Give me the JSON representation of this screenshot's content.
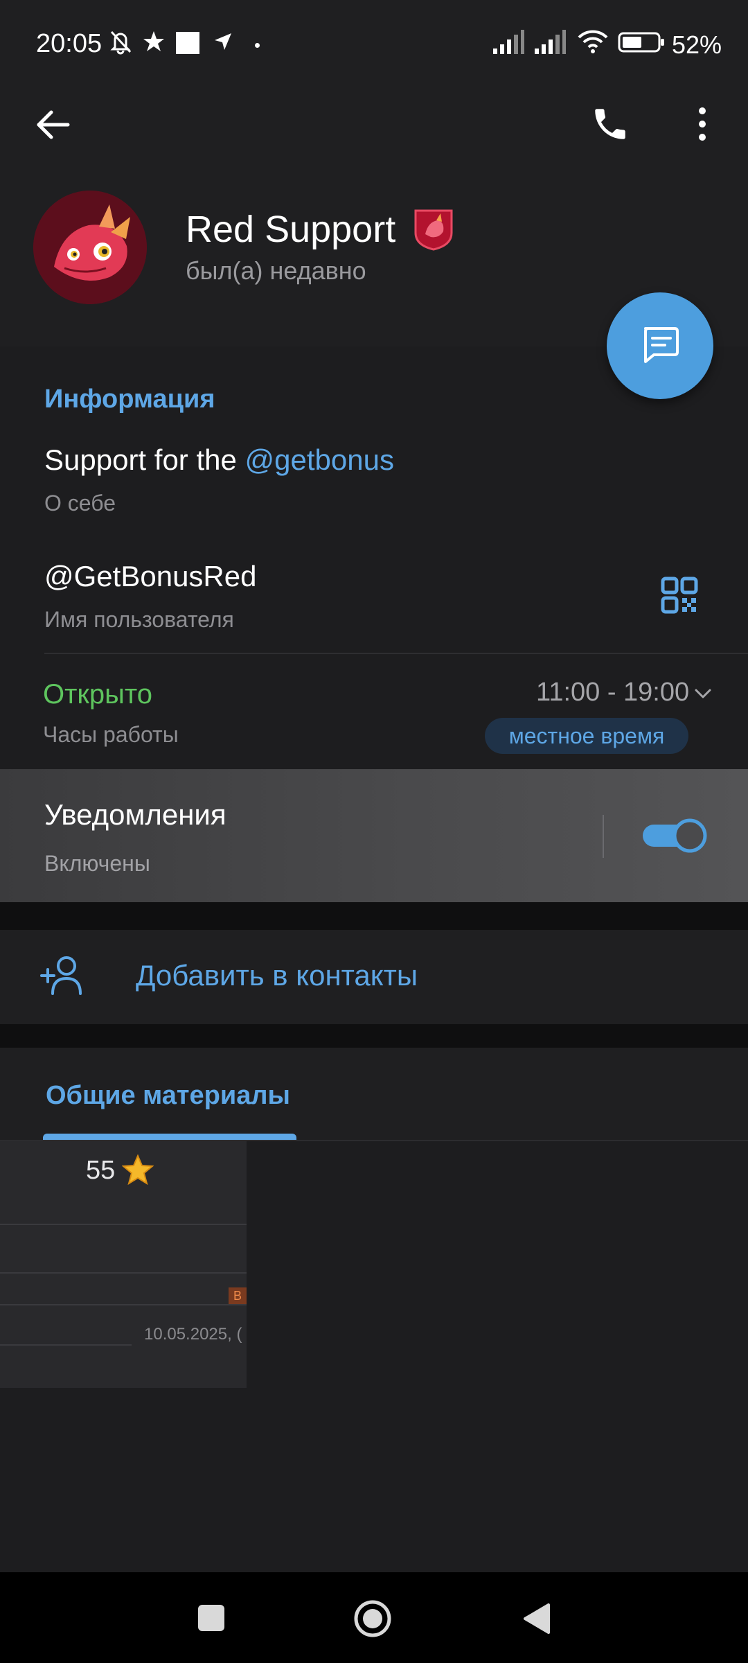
{
  "status_bar": {
    "time": "20:05",
    "battery_percent": "52%",
    "icons": [
      "bell-off-icon",
      "star-icon",
      "square-icon",
      "navigation-icon",
      "dot-icon",
      "signal-icon",
      "signal-icon",
      "wifi-icon",
      "battery-icon"
    ]
  },
  "app_bar": {
    "back_icon": "arrow-left-icon",
    "call_icon": "phone-icon",
    "menu_icon": "more-vert-icon"
  },
  "profile": {
    "name": "Red Support",
    "status": "был(а) недавно",
    "badge_icon": "dragon-badge-icon",
    "avatar_icon": "dragon-avatar"
  },
  "fab": {
    "icon": "message-icon"
  },
  "info": {
    "title": "Информация",
    "bio_prefix": "Support for the ",
    "bio_mention": "@getbonus",
    "bio_label": "О себе",
    "username": "@GetBonusRed",
    "username_label": "Имя пользователя",
    "hours_status": "Открыто",
    "hours_label": "Часы работы",
    "hours_range": "11:00 - 19:00",
    "local_time_chip": "местное время"
  },
  "notifications": {
    "title": "Уведомления",
    "subtitle": "Включены",
    "enabled": true
  },
  "add_contact": {
    "label": "Добавить в контакты"
  },
  "shared_media": {
    "tab_label": "Общие материалы",
    "thumbnail": {
      "price": "55",
      "date": "10.05.2025, (",
      "tag": "В"
    }
  },
  "nav_bar": {
    "icons": [
      "recent-apps-icon",
      "home-icon",
      "back-icon"
    ]
  },
  "colors": {
    "accent": "#5ea7e6",
    "fab": "#4d9ede",
    "open_status": "#5ec55e",
    "background": "#1d1d1f"
  }
}
